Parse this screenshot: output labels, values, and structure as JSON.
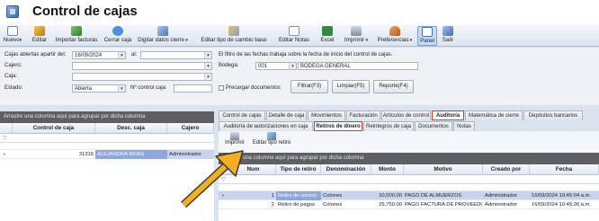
{
  "window": {
    "title": "Control de cajas"
  },
  "toolbar": {
    "nuevo": "Nuevo",
    "editar": "Editar",
    "importar": "Importar facturas",
    "cerrar": "Cerrar caja",
    "digitar": "Digitar datos cierre",
    "editar_tipo": "Editar tipo de cambio base",
    "editar_notas": "Editar Notas",
    "excel": "Excel",
    "imprimir": "Imprimir",
    "preferencias": "Preferencias",
    "panel": "Panel",
    "salir": "Salir"
  },
  "filters": {
    "cajas_label": "Cajas abiertas apartir del:",
    "cajas_value": "16/09/2024",
    "al_label": "al:",
    "al_value": "",
    "cajero_label": "Cajero:",
    "caja_label": "Caja:",
    "estado_label": "Estado:",
    "estado_value": "Abierta",
    "control_label": "Nº control caja:",
    "info_text": "El filtro de las fechas trabaja sobre la fecha de inicio del control de cajas.",
    "bodega_label": "Bodega:",
    "bodega_code": "001",
    "bodega_name": "BODEGA GENERAL",
    "precargar_label": "Precargar documentos",
    "filtrar": "Filtrar(F3)",
    "limpiar": "Limpiar(F5)",
    "reporte": "Reporte(F4)"
  },
  "left_grid": {
    "groupbar": "Arrastre una columna aquí para agrupar por dicha columna",
    "columns": [
      "Control de caja",
      "Desc. caja",
      "Cajero"
    ],
    "rows": [
      {
        "control": "31316",
        "desc": "ALEJANDRA RIVAS",
        "cajero": "Administrador"
      }
    ]
  },
  "tabs_top": [
    "Control de cajas",
    "Detalle de caja",
    "Movimientos",
    "Facturación",
    "Artículos de control",
    "Auditoría",
    "Matemática de cierre",
    "Depósitos bancarios"
  ],
  "tabs_sub": [
    "Auditoría de autorizaciones en caja",
    "Retiros de dinero",
    "Reintegros de caja",
    "Documentos",
    "Notas"
  ],
  "sub_toolbar": {
    "imprimir": "Imprimir",
    "editar_tipo": "Editar tipo retiro"
  },
  "right_grid": {
    "groupbar": "Arrastre una columna aquí para agrupar por dicha columna",
    "columns": [
      "Num",
      "Tipo de retiro",
      "Denominación",
      "Monto",
      "Motivo",
      "Creado por",
      "Fecha"
    ],
    "rows": [
      {
        "num": "1",
        "tipo": "Retiro de control",
        "denom": "Colones",
        "monto": "10,000.00",
        "motivo": "PAGO DE ALMUERZOS",
        "creado": "Administrador",
        "fecha": "16/09/2024 10:45:04 a.m."
      },
      {
        "num": "2",
        "tipo": "Retiro de pagos",
        "denom": "Colones",
        "monto": "25,750.00",
        "motivo": "PAGO FACTURA DE PROVEEDOR",
        "creado": "Administrador",
        "fecha": "16/09/2024 10:45:26 a.m."
      }
    ]
  },
  "colors": {
    "highlight": "#e2351e",
    "arrow": "#f2b01e",
    "selection": "#8ea7de"
  }
}
